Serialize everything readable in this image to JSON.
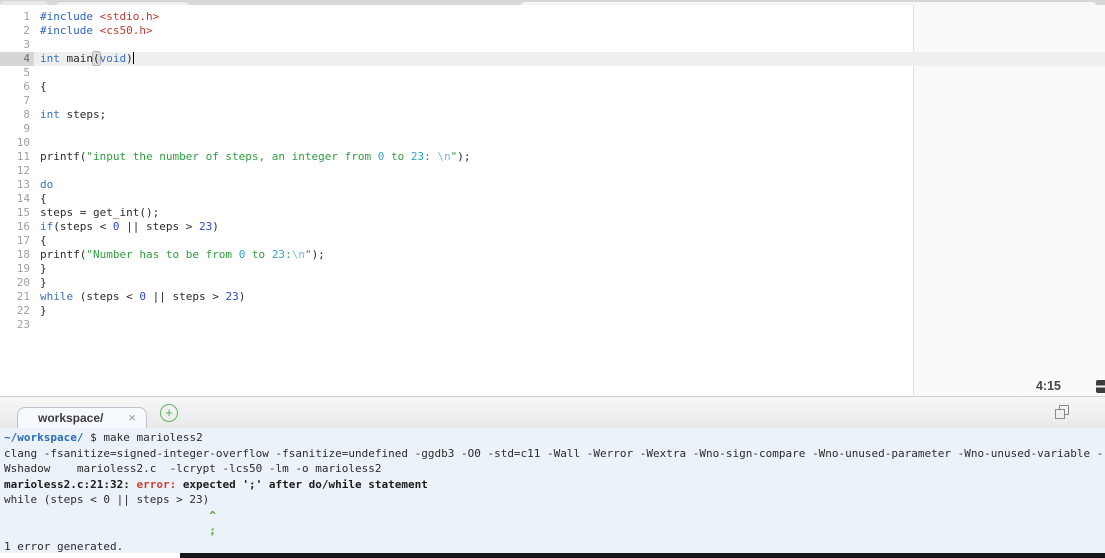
{
  "colors": {
    "keyword_blue": "#3a70c3",
    "include_red": "#c23b30",
    "string_green": "#2f9e3f",
    "string_number_teal": "#2ba3c7",
    "escape_blue": "#79bbdd",
    "number_blue": "#2d49c9",
    "prompt_blue": "#2a6db5",
    "error_red": "#d23f31",
    "caret_green": "#53a626",
    "add_tab_green": "#5cb85c",
    "terminal_bg": "#ecf2f9",
    "active_line_bg": "#efefef"
  },
  "editor": {
    "active_line": 4,
    "cursor_position_label": "4:15",
    "lines": [
      {
        "n": 1,
        "segs": [
          [
            "pre",
            "#include"
          ],
          [
            "txt",
            " "
          ],
          [
            "inc",
            "<stdio.h>"
          ]
        ]
      },
      {
        "n": 2,
        "segs": [
          [
            "pre",
            "#include"
          ],
          [
            "txt",
            " "
          ],
          [
            "inc",
            "<cs50.h>"
          ]
        ]
      },
      {
        "n": 3,
        "segs": []
      },
      {
        "n": 4,
        "segs": [
          [
            "kw",
            "int"
          ],
          [
            "txt",
            " main"
          ],
          [
            "brkt",
            "("
          ],
          [
            "kw",
            "void"
          ],
          [
            "txt",
            ")"
          ],
          [
            "cursor",
            ""
          ]
        ]
      },
      {
        "n": 5,
        "segs": []
      },
      {
        "n": 6,
        "segs": [
          [
            "txt",
            "{"
          ]
        ]
      },
      {
        "n": 7,
        "segs": []
      },
      {
        "n": 8,
        "segs": [
          [
            "kw",
            "int"
          ],
          [
            "txt",
            " steps;"
          ]
        ]
      },
      {
        "n": 9,
        "segs": []
      },
      {
        "n": 10,
        "segs": []
      },
      {
        "n": 11,
        "segs": [
          [
            "txt",
            "printf("
          ],
          [
            "str",
            "\"input the number of steps, an integer from "
          ],
          [
            "snum",
            "0"
          ],
          [
            "str",
            " to "
          ],
          [
            "snum",
            "23"
          ],
          [
            "str",
            ": "
          ],
          [
            "esc",
            "\\n"
          ],
          [
            "str",
            "\""
          ],
          [
            "txt",
            ");"
          ]
        ]
      },
      {
        "n": 12,
        "segs": []
      },
      {
        "n": 13,
        "segs": [
          [
            "kw",
            "do"
          ]
        ]
      },
      {
        "n": 14,
        "segs": [
          [
            "txt",
            "{"
          ]
        ]
      },
      {
        "n": 15,
        "segs": [
          [
            "txt",
            "steps = get_int();"
          ]
        ]
      },
      {
        "n": 16,
        "segs": [
          [
            "kw",
            "if"
          ],
          [
            "txt",
            "(steps < "
          ],
          [
            "num",
            "0"
          ],
          [
            "txt",
            " || steps > "
          ],
          [
            "num",
            "23"
          ],
          [
            "txt",
            ")"
          ]
        ]
      },
      {
        "n": 17,
        "segs": [
          [
            "txt",
            "{"
          ]
        ]
      },
      {
        "n": 18,
        "segs": [
          [
            "txt",
            "printf("
          ],
          [
            "str",
            "\"Number has to be from "
          ],
          [
            "snum",
            "0"
          ],
          [
            "str",
            " to "
          ],
          [
            "snum",
            "23"
          ],
          [
            "str",
            ":"
          ],
          [
            "esc",
            "\\n"
          ],
          [
            "str",
            "\""
          ],
          [
            "txt",
            ");"
          ]
        ]
      },
      {
        "n": 19,
        "segs": [
          [
            "txt",
            "}"
          ]
        ]
      },
      {
        "n": 20,
        "segs": [
          [
            "txt",
            "}"
          ]
        ]
      },
      {
        "n": 21,
        "segs": [
          [
            "kw",
            "while"
          ],
          [
            "txt",
            " (steps < "
          ],
          [
            "num",
            "0"
          ],
          [
            "txt",
            " || steps > "
          ],
          [
            "num",
            "23"
          ],
          [
            "txt",
            ")"
          ]
        ]
      },
      {
        "n": 22,
        "segs": [
          [
            "txt",
            "}"
          ]
        ]
      },
      {
        "n": 23,
        "segs": []
      }
    ]
  },
  "terminal": {
    "tab_label": "workspace/",
    "close_icon": "×",
    "add_icon": "+",
    "lines": [
      {
        "segs": [
          [
            "prompt",
            "~/workspace/"
          ],
          [
            "txt",
            " $ make marioless2"
          ]
        ]
      },
      {
        "segs": [
          [
            "txt",
            "clang -fsanitize=signed-integer-overflow -fsanitize=undefined -ggdb3 -O0 -std=c11 -Wall -Werror -Wextra -Wno-sign-compare -Wno-unused-parameter -Wno-unused-variable -"
          ]
        ]
      },
      {
        "segs": [
          [
            "txt",
            "Wshadow    marioless2.c  -lcrypt -lcs50 -lm -o marioless2"
          ]
        ]
      },
      {
        "segs": [
          [
            "b",
            "marioless2.c:21:32: "
          ],
          [
            "err",
            "error: "
          ],
          [
            "b",
            "expected ';' after do/while statement"
          ]
        ]
      },
      {
        "segs": [
          [
            "txt",
            "while (steps < 0 || steps > 23)"
          ]
        ]
      },
      {
        "segs": [
          [
            "caret",
            "                               ^"
          ]
        ]
      },
      {
        "segs": [
          [
            "caret",
            "                               ;"
          ]
        ]
      },
      {
        "segs": [
          [
            "txt",
            "1 error generated."
          ]
        ]
      }
    ]
  }
}
